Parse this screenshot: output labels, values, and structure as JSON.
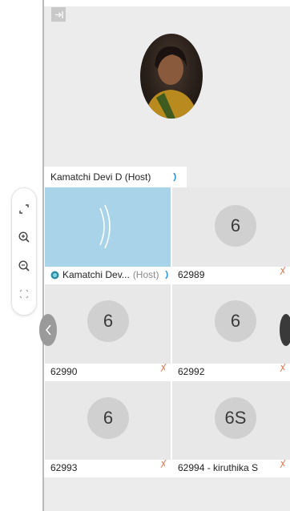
{
  "host": {
    "name_label": "Kamatchi Devi D (Host)"
  },
  "participants": [
    {
      "name": "Kamatchi Dev...",
      "role": "(Host)",
      "avatar_text": "",
      "active": true
    },
    {
      "name": "62989",
      "avatar_text": "6"
    },
    {
      "name": "62990",
      "avatar_text": "6"
    },
    {
      "name": "62992",
      "avatar_text": "6"
    },
    {
      "name": "62993",
      "avatar_text": "6"
    },
    {
      "name": "62994 - kiruthika S",
      "avatar_text": "6S"
    }
  ],
  "colors": {
    "active_tile": "#a9d3e8",
    "accent": "#2a8fd6",
    "muted_mic": "#d98a6a"
  },
  "icons": {
    "collapse": "collapse-panel-icon",
    "fullscreen": "fullscreen-icon",
    "zoom_in": "zoom-in-icon",
    "zoom_out": "zoom-out-icon",
    "fit": "fit-screen-icon",
    "audio": "audio-wave-icon",
    "mic_muted": "mic-muted-icon"
  }
}
